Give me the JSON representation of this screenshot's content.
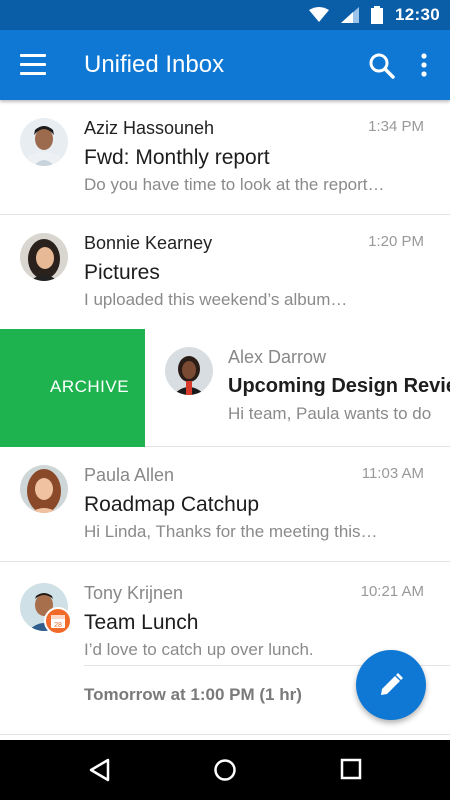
{
  "status_bar": {
    "time": "12:30",
    "icons": [
      "wifi-icon",
      "signal-icon",
      "battery-icon"
    ]
  },
  "app_bar": {
    "title": "Unified Inbox",
    "icons": [
      "menu-icon",
      "search-icon",
      "more-vert-icon"
    ]
  },
  "colors": {
    "primary": "#0f78d4",
    "status": "#0a5ea8",
    "archive": "#1eb34f",
    "badge": "#f26a2a"
  },
  "messages": [
    {
      "sender": "Aziz Hassouneh",
      "time": "1:34 PM",
      "subject": "Fwd: Monthly report",
      "preview": "Do you have time to look at the report…",
      "unread": true
    },
    {
      "sender": "Bonnie Kearney",
      "time": "1:20 PM",
      "subject": "Pictures",
      "preview": "I uploaded this weekend’s album…",
      "unread": true
    },
    {
      "sender": "Alex Darrow",
      "time": "",
      "subject": "Upcoming Design Review",
      "preview": "Hi team, Paula wants to do",
      "unread": false,
      "swipe_action": "ARCHIVE"
    },
    {
      "sender": "Paula Allen",
      "time": "11:03 AM",
      "subject": "Roadmap Catchup",
      "preview": "Hi Linda, Thanks for the meeting this…",
      "unread": false
    },
    {
      "sender": "Tony Krijnen",
      "time": "10:21 AM",
      "subject": "Team Lunch",
      "preview": "I’d love to catch up over lunch.",
      "unread": false,
      "event": "Tomorrow at 1:00 PM (1 hr)",
      "calendar_day": "28"
    }
  ],
  "fab": {
    "icon": "compose-icon"
  },
  "nav_bar": {
    "icons": [
      "back-icon",
      "home-icon",
      "recents-icon"
    ]
  }
}
